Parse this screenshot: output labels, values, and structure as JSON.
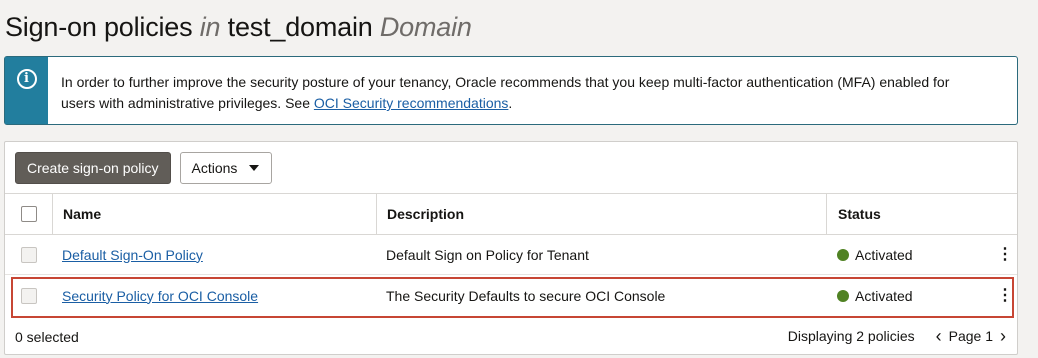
{
  "page": {
    "title_prefix": "Sign-on policies",
    "title_in": "in",
    "title_domain_name": "test_domain",
    "title_domain_word": "Domain"
  },
  "banner": {
    "icon": "info-icon",
    "text_line1": "In order to further improve the security posture of your tenancy, Oracle recommends that you keep multi-factor authentication (MFA) enabled for",
    "text_line2": "users with administrative privileges. See ",
    "link_text": "OCI Security recommendations",
    "text_end": "."
  },
  "toolbar": {
    "create_label": "Create sign-on policy",
    "actions_label": "Actions"
  },
  "table": {
    "columns": [
      "Name",
      "Description",
      "Status"
    ],
    "rows": [
      {
        "name": "Default Sign-On Policy",
        "description": "Default Sign on Policy for Tenant",
        "status": "Activated"
      },
      {
        "name": "Security Policy for OCI Console",
        "description": "The Security Defaults to secure OCI Console",
        "status": "Activated"
      }
    ]
  },
  "footer": {
    "selected": "0 selected",
    "displaying": "Displaying 2 policies",
    "page": "Page 1"
  },
  "colors": {
    "status_activated": "#508223",
    "highlight": "#c74634",
    "banner_accent": "#227e9e"
  }
}
